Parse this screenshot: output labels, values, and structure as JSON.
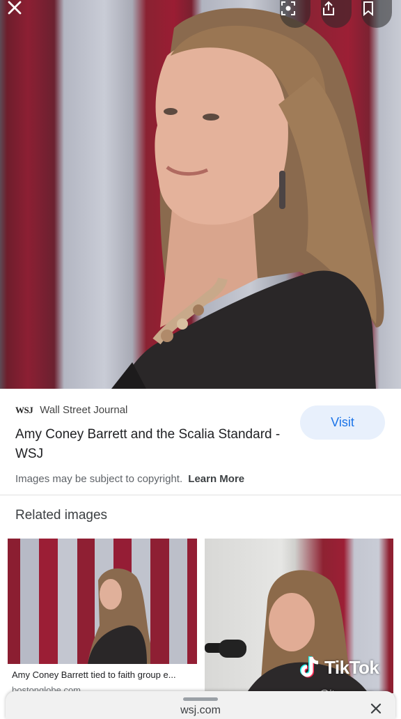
{
  "viewer": {
    "close_icon": "close-icon",
    "lens_icon": "lens-icon",
    "share_icon": "share-icon",
    "bookmark_icon": "bookmark-icon"
  },
  "result": {
    "source_logo": "WSJ",
    "source_name": "Wall Street Journal",
    "title": "Amy Coney Barrett and the Scalia Standard - WSJ",
    "visit_label": "Visit",
    "copyright_text": "Images may be subject to copyright.",
    "learn_more_label": "Learn More"
  },
  "related": {
    "heading": "Related images",
    "items": [
      {
        "caption": "Amy Coney Barrett tied to faith group e...",
        "domain": "bostonglobe.com"
      },
      {
        "caption": "",
        "domain": ""
      }
    ]
  },
  "bottom_sheet": {
    "domain": "wsj.com",
    "close_icon": "close-icon"
  },
  "overlay": {
    "brand": "TikTok",
    "handle": "@itssevonn"
  },
  "colors": {
    "accent": "#1a73e8",
    "visit_bg": "#e8f0fc"
  }
}
